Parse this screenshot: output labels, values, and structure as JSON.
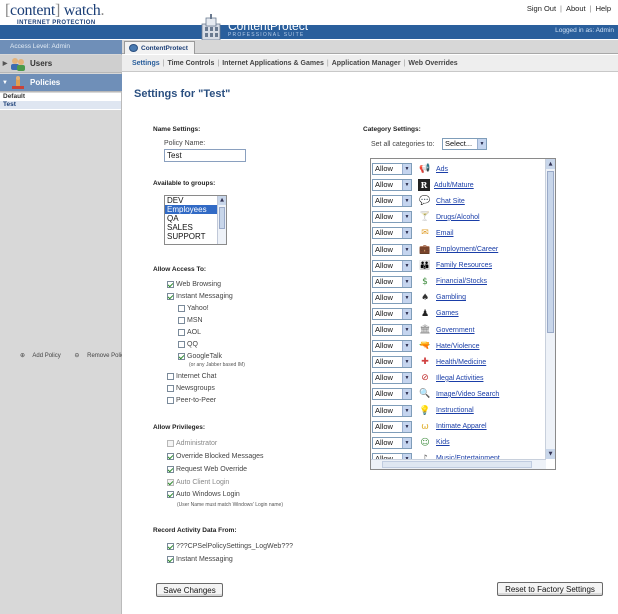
{
  "header": {
    "logo_bracket_open": "[",
    "logo_name": "content",
    "logo_bracket_close": "]",
    "logo_suffix": " watch",
    "logo_tm": ".",
    "logo_tagline": "INTERNET PROTECTION",
    "product_title": "ContentProtect",
    "product_subtitle": "PROFESSIONAL SUITE",
    "top_links": [
      "Sign Out",
      "About",
      "Help"
    ],
    "logged_in": "Logged in as: Admin",
    "access_level": "Access Level: Admin"
  },
  "tab": {
    "label": "ContentProtect"
  },
  "nav": {
    "items": [
      "Settings",
      "Time Controls",
      "Internet Applications & Games",
      "Application Manager",
      "Web Overrides"
    ],
    "active": "Settings"
  },
  "sidebar": {
    "users_label": "Users",
    "policies_label": "Policies",
    "policies": [
      {
        "name": "Default",
        "selected": false
      },
      {
        "name": "Test",
        "selected": true
      }
    ],
    "add_policy": "Add Policy",
    "remove_policy": "Remove Policy"
  },
  "page": {
    "title": "Settings for \"Test\"",
    "name_settings": {
      "heading": "Name Settings:",
      "label": "Policy Name:",
      "value": "Test"
    },
    "groups": {
      "heading": "Available to groups:",
      "items": [
        {
          "name": "DEV",
          "selected": false
        },
        {
          "name": "Employees",
          "selected": true
        },
        {
          "name": "QA",
          "selected": false
        },
        {
          "name": "SALES",
          "selected": false
        },
        {
          "name": "SUPPORT",
          "selected": false
        }
      ]
    },
    "access": {
      "heading": "Allow Access To:",
      "web_browsing": "Web Browsing",
      "instant_messaging": "Instant Messaging",
      "yahoo": "Yahoo!",
      "msn": "MSN",
      "aol": "AOL",
      "qq": "QQ",
      "googletalk": "GoogleTalk",
      "googletalk_note": "(or any Jabber based IM)",
      "internet_chat": "Internet Chat",
      "newsgroups": "Newsgroups",
      "p2p": "Peer-to-Peer"
    },
    "privileges": {
      "heading": "Allow Privileges:",
      "administrator": "Administrator",
      "override_blocked": "Override Blocked Messages",
      "request_override": "Request Web Override",
      "auto_client": "Auto Client Login",
      "auto_windows": "Auto Windows Login",
      "auto_windows_note": "(User Name must match Windows' Login name)"
    },
    "record": {
      "heading": "Record Activity Data From:",
      "logweb": "???CPSelPolicySettings_LogWeb???",
      "im": "Instant Messaging"
    },
    "save_button": "Save Changes",
    "reset_button": "Reset to Factory Settings"
  },
  "categories": {
    "heading": "Category Settings:",
    "set_all_label": "Set all categories to:",
    "set_all_value": "Select...",
    "items": [
      {
        "action": "Allow",
        "name": "Ads",
        "icon": "megaphone-icon",
        "glyph": "📢"
      },
      {
        "action": "Allow",
        "name": "Adult/Mature",
        "icon": "rated-r-icon",
        "glyph": "R"
      },
      {
        "action": "Allow",
        "name": "Chat Site",
        "icon": "chat-bubble-icon",
        "glyph": "💬"
      },
      {
        "action": "Allow",
        "name": "Drugs/Alcohol",
        "icon": "cocktail-icon",
        "glyph": "🍸"
      },
      {
        "action": "Allow",
        "name": "Email",
        "icon": "envelope-icon",
        "glyph": "✉"
      },
      {
        "action": "Allow",
        "name": "Employment/Career",
        "icon": "briefcase-icon",
        "glyph": "💼"
      },
      {
        "action": "Allow",
        "name": "Family Resources",
        "icon": "family-icon",
        "glyph": "👪"
      },
      {
        "action": "Allow",
        "name": "Financial/Stocks",
        "icon": "dollar-icon",
        "glyph": "$"
      },
      {
        "action": "Allow",
        "name": "Gambling",
        "icon": "spade-icon",
        "glyph": "♠"
      },
      {
        "action": "Allow",
        "name": "Games",
        "icon": "game-piece-icon",
        "glyph": "♟"
      },
      {
        "action": "Allow",
        "name": "Government",
        "icon": "capitol-icon",
        "glyph": "🏛"
      },
      {
        "action": "Allow",
        "name": "Hate/Violence",
        "icon": "gun-icon",
        "glyph": "🔫"
      },
      {
        "action": "Allow",
        "name": "Health/Medicine",
        "icon": "red-cross-icon",
        "glyph": "✚"
      },
      {
        "action": "Allow",
        "name": "Illegal Activities",
        "icon": "prohibited-icon",
        "glyph": "⊘"
      },
      {
        "action": "Allow",
        "name": "Image/Video Search",
        "icon": "magnifier-icon",
        "glyph": "🔍"
      },
      {
        "action": "Allow",
        "name": "Instructional",
        "icon": "lightbulb-icon",
        "glyph": "💡"
      },
      {
        "action": "Allow",
        "name": "Intimate Apparel",
        "icon": "lingerie-icon",
        "glyph": "ω"
      },
      {
        "action": "Allow",
        "name": "Kids",
        "icon": "kid-icon",
        "glyph": "☺"
      },
      {
        "action": "Allow",
        "name": "Music/Entertainment",
        "icon": "music-note-icon",
        "glyph": "♪"
      }
    ]
  },
  "colors": {
    "brand_blue": "#2a5f9c",
    "link_blue": "#1a3ea8",
    "selection": "#316ac5"
  }
}
